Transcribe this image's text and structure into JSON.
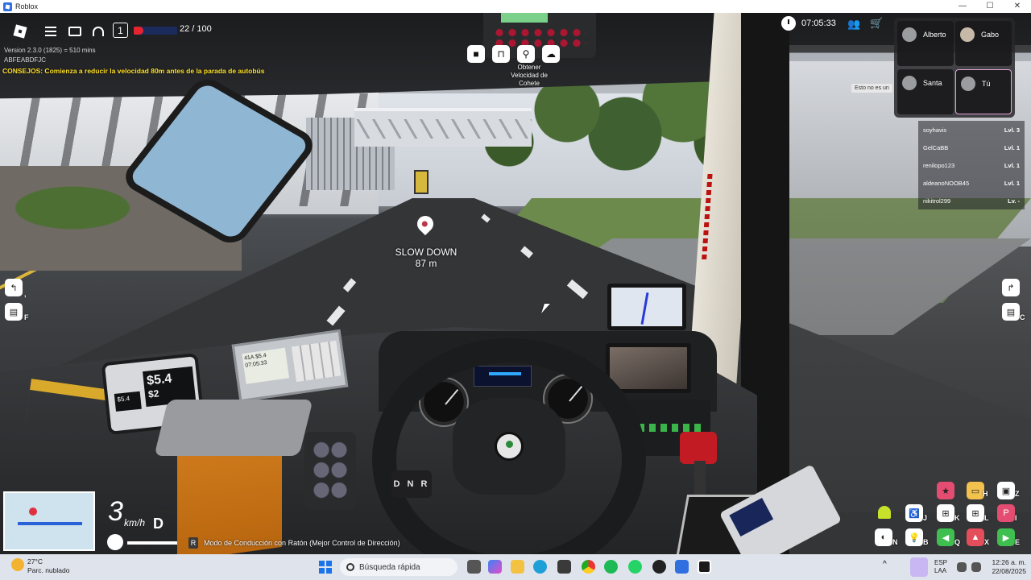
{
  "window": {
    "title": "Roblox",
    "controls": [
      "—",
      "☐",
      "✕"
    ]
  },
  "hud": {
    "player_count": "1",
    "health": {
      "text": "22 / 100",
      "fill_fraction": 0.22
    },
    "version": "Version 2.3.0 (1825) = 510 mins",
    "build_id": "ABFEABDFJC",
    "tip": "CONSEJOS: Comienza a reducir la velocidad 80m antes de la parada de autobús",
    "rocket_label": "Obtener Velocidad de Cohete",
    "clock": "07:05:33",
    "waypoint": {
      "title": "SLOW DOWN",
      "distance": "87 m"
    },
    "note": "Esto no es un",
    "speed": {
      "value": "3",
      "unit": "km/h",
      "gear": "D"
    },
    "mode_key": "R",
    "mode_text": "Modo de Conducción con Ratón (Mejor Control de Dirección)",
    "side_keys": {
      "left_top": ",",
      "left_bottom": "F",
      "right_bottom": "C"
    }
  },
  "dashboard": {
    "fare_large": "$5.4",
    "fare_small": "$5.4",
    "fare_partial": "$2",
    "ticket_screen": [
      "41A  $5.4",
      "07:05:33"
    ],
    "gear_selector": "D N R"
  },
  "players": [
    {
      "name": "Alberto"
    },
    {
      "name": "Gabo"
    },
    {
      "name": "Santa"
    },
    {
      "name": "Tú"
    }
  ],
  "leaderboard": [
    {
      "name": "soyhavis",
      "level": "Lvl. 3"
    },
    {
      "name": "GelCaBB",
      "level": "Lvl. 1"
    },
    {
      "name": "renilopo123",
      "level": "Lvl. 1"
    },
    {
      "name": "aldeanoNOOB45",
      "level": "Lvl. 1"
    },
    {
      "name": "nikitrol299",
      "level": "Lv. -"
    }
  ],
  "bottom_right_keys": [
    "Z",
    "H",
    "J",
    "K",
    "L",
    "I",
    "N",
    "B",
    "Q",
    "X",
    "E"
  ],
  "taskbar": {
    "weather_temp": "27°C",
    "weather_desc": "Parc. nublado",
    "search_placeholder": "Búsqueda rápida",
    "lang_top": "ESP",
    "lang_bottom": "LAA",
    "time": "12:26 a. m.",
    "date": "22/08/2025"
  }
}
